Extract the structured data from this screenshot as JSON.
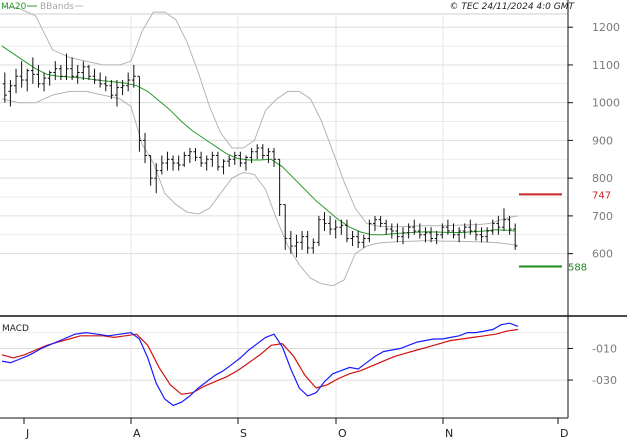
{
  "chart_data": {
    "type": "line",
    "header": {
      "ma_legend": "MA20",
      "bb_legend": "BBands",
      "copyright": "© TEC 24/11/2024 4:0 GMT",
      "macd_title": "MACD"
    },
    "x_axis_labels": [
      "J",
      "A",
      "S",
      "O",
      "N",
      "D"
    ],
    "price_axis": {
      "ticks": [
        1200,
        1100,
        1000,
        900,
        800,
        700,
        600
      ],
      "tick_labels": [
        "1200",
        "1100",
        "1000",
        "900",
        "800",
        "700",
        "600"
      ],
      "range": [
        440,
        1235
      ],
      "grid": true
    },
    "macd_axis": {
      "ticks": [
        -10,
        -30
      ],
      "tick_labels": [
        "-010",
        "-030"
      ],
      "range": [
        -54,
        8
      ]
    },
    "levels": [
      {
        "label": "747",
        "value": 757,
        "color": "#c62828"
      },
      {
        "label": "588",
        "value": 566,
        "color": "#1d8a1d"
      }
    ],
    "colors": {
      "price_bars": "#111111",
      "ma20": "#2a9a2a",
      "bbands": "#b5b5b5",
      "macd": "#1a1aff",
      "signal": "#d01010",
      "grid": "#dcdcdc"
    },
    "price_bars": [
      [
        1,
        1050,
        1080,
        1000,
        1020
      ],
      [
        3,
        1030,
        1060,
        990,
        1045
      ],
      [
        5,
        1045,
        1090,
        1025,
        1070
      ],
      [
        7,
        1070,
        1110,
        1040,
        1060
      ],
      [
        9,
        1060,
        1090,
        1030,
        1085
      ],
      [
        11,
        1085,
        1120,
        1050,
        1075
      ],
      [
        13,
        1075,
        1100,
        1040,
        1050
      ],
      [
        15,
        1050,
        1080,
        1030,
        1065
      ],
      [
        17,
        1065,
        1085,
        1045,
        1080
      ],
      [
        19,
        1080,
        1110,
        1060,
        1090
      ],
      [
        21,
        1090,
        1100,
        1060,
        1070
      ],
      [
        23,
        1070,
        1130,
        1060,
        1090
      ],
      [
        25,
        1090,
        1120,
        1060,
        1070
      ],
      [
        27,
        1070,
        1100,
        1050,
        1080
      ],
      [
        29,
        1080,
        1110,
        1060,
        1095
      ],
      [
        31,
        1095,
        1100,
        1060,
        1070
      ],
      [
        33,
        1070,
        1090,
        1050,
        1060
      ],
      [
        35,
        1060,
        1080,
        1040,
        1050
      ],
      [
        37,
        1050,
        1070,
        1030,
        1045
      ],
      [
        39,
        1045,
        1060,
        1010,
        1020
      ],
      [
        41,
        1020,
        1060,
        990,
        1040
      ],
      [
        43,
        1040,
        1060,
        1020,
        1045
      ],
      [
        45,
        1045,
        1080,
        1030,
        1060
      ],
      [
        47,
        1060,
        1100,
        1040,
        1070
      ],
      [
        49,
        1070,
        1000,
        870,
        900
      ],
      [
        51,
        900,
        920,
        840,
        860
      ],
      [
        53,
        860,
        850,
        780,
        800
      ],
      [
        55,
        800,
        840,
        760,
        820
      ],
      [
        57,
        820,
        860,
        810,
        840
      ],
      [
        59,
        840,
        870,
        820,
        850
      ],
      [
        61,
        850,
        860,
        820,
        840
      ],
      [
        63,
        840,
        860,
        820,
        835
      ],
      [
        65,
        835,
        870,
        830,
        860
      ],
      [
        67,
        860,
        880,
        840,
        870
      ],
      [
        69,
        870,
        880,
        845,
        855
      ],
      [
        71,
        855,
        870,
        830,
        840
      ],
      [
        73,
        840,
        860,
        820,
        850
      ],
      [
        75,
        850,
        870,
        830,
        860
      ],
      [
        77,
        860,
        870,
        820,
        830
      ],
      [
        79,
        830,
        850,
        810,
        845
      ],
      [
        81,
        845,
        860,
        830,
        850
      ],
      [
        83,
        850,
        870,
        835,
        860
      ],
      [
        85,
        860,
        870,
        830,
        840
      ],
      [
        87,
        840,
        860,
        820,
        855
      ],
      [
        89,
        855,
        880,
        840,
        870
      ],
      [
        91,
        870,
        890,
        850,
        880
      ],
      [
        93,
        880,
        890,
        850,
        860
      ],
      [
        95,
        860,
        880,
        840,
        870
      ],
      [
        97,
        870,
        880,
        830,
        850
      ],
      [
        99,
        850,
        820,
        700,
        730
      ],
      [
        101,
        730,
        700,
        610,
        640
      ],
      [
        103,
        640,
        660,
        600,
        620
      ],
      [
        105,
        620,
        650,
        590,
        630
      ],
      [
        107,
        630,
        660,
        610,
        645
      ],
      [
        109,
        645,
        660,
        600,
        615
      ],
      [
        111,
        615,
        640,
        600,
        630
      ],
      [
        113,
        630,
        700,
        620,
        690
      ],
      [
        115,
        690,
        710,
        660,
        680
      ],
      [
        117,
        680,
        700,
        650,
        665
      ],
      [
        119,
        665,
        690,
        640,
        670
      ],
      [
        121,
        670,
        690,
        650,
        675
      ],
      [
        123,
        675,
        690,
        630,
        640
      ],
      [
        125,
        640,
        660,
        620,
        645
      ],
      [
        127,
        645,
        660,
        615,
        630
      ],
      [
        129,
        630,
        650,
        615,
        640
      ],
      [
        131,
        640,
        690,
        630,
        680
      ],
      [
        133,
        680,
        700,
        660,
        690
      ],
      [
        135,
        690,
        700,
        670,
        680
      ],
      [
        137,
        680,
        690,
        650,
        665
      ],
      [
        139,
        665,
        680,
        640,
        660
      ],
      [
        141,
        660,
        680,
        630,
        645
      ],
      [
        143,
        645,
        670,
        625,
        655
      ],
      [
        145,
        655,
        680,
        640,
        670
      ],
      [
        147,
        670,
        690,
        650,
        660
      ],
      [
        149,
        660,
        680,
        640,
        650
      ],
      [
        151,
        650,
        670,
        630,
        655
      ],
      [
        153,
        655,
        670,
        630,
        640
      ],
      [
        155,
        640,
        660,
        625,
        650
      ],
      [
        157,
        650,
        680,
        640,
        670
      ],
      [
        159,
        670,
        690,
        650,
        660
      ],
      [
        161,
        660,
        680,
        640,
        650
      ],
      [
        163,
        650,
        670,
        630,
        660
      ],
      [
        165,
        660,
        680,
        640,
        670
      ],
      [
        167,
        670,
        690,
        650,
        660
      ],
      [
        169,
        660,
        680,
        635,
        650
      ],
      [
        171,
        650,
        670,
        630,
        645
      ],
      [
        173,
        645,
        670,
        630,
        660
      ],
      [
        175,
        660,
        690,
        650,
        680
      ],
      [
        177,
        680,
        700,
        650,
        670
      ],
      [
        179,
        670,
        720,
        660,
        690
      ],
      [
        181,
        690,
        700,
        650,
        665
      ],
      [
        183,
        665,
        680,
        610,
        620
      ]
    ],
    "ma20": [
      [
        0,
        1150
      ],
      [
        4,
        1130
      ],
      [
        8,
        1110
      ],
      [
        12,
        1090
      ],
      [
        16,
        1075
      ],
      [
        20,
        1070
      ],
      [
        24,
        1068
      ],
      [
        28,
        1066
      ],
      [
        32,
        1062
      ],
      [
        36,
        1058
      ],
      [
        40,
        1055
      ],
      [
        44,
        1052
      ],
      [
        48,
        1045
      ],
      [
        52,
        1030
      ],
      [
        56,
        1005
      ],
      [
        60,
        980
      ],
      [
        64,
        950
      ],
      [
        68,
        925
      ],
      [
        72,
        905
      ],
      [
        76,
        885
      ],
      [
        80,
        865
      ],
      [
        84,
        852
      ],
      [
        88,
        848
      ],
      [
        92,
        848
      ],
      [
        96,
        850
      ],
      [
        100,
        830
      ],
      [
        104,
        800
      ],
      [
        108,
        770
      ],
      [
        112,
        740
      ],
      [
        116,
        715
      ],
      [
        120,
        690
      ],
      [
        124,
        670
      ],
      [
        128,
        657
      ],
      [
        132,
        650
      ],
      [
        136,
        650
      ],
      [
        140,
        653
      ],
      [
        144,
        655
      ],
      [
        148,
        657
      ],
      [
        152,
        658
      ],
      [
        156,
        657
      ],
      [
        160,
        656
      ],
      [
        164,
        656
      ],
      [
        168,
        658
      ],
      [
        172,
        660
      ],
      [
        176,
        663
      ],
      [
        180,
        662
      ],
      [
        183,
        660
      ]
    ],
    "bb_upper": [
      [
        0,
        1255
      ],
      [
        6,
        1250
      ],
      [
        12,
        1230
      ],
      [
        18,
        1140
      ],
      [
        24,
        1120
      ],
      [
        30,
        1110
      ],
      [
        36,
        1100
      ],
      [
        42,
        1100
      ],
      [
        46,
        1110
      ],
      [
        50,
        1190
      ],
      [
        54,
        1240
      ],
      [
        58,
        1240
      ],
      [
        62,
        1220
      ],
      [
        66,
        1160
      ],
      [
        70,
        1080
      ],
      [
        74,
        990
      ],
      [
        78,
        920
      ],
      [
        82,
        880
      ],
      [
        86,
        880
      ],
      [
        90,
        900
      ],
      [
        94,
        980
      ],
      [
        98,
        1010
      ],
      [
        102,
        1030
      ],
      [
        106,
        1030
      ],
      [
        110,
        1010
      ],
      [
        114,
        950
      ],
      [
        118,
        870
      ],
      [
        122,
        790
      ],
      [
        126,
        720
      ],
      [
        130,
        680
      ],
      [
        134,
        673
      ],
      [
        138,
        671
      ],
      [
        142,
        671
      ],
      [
        146,
        673
      ],
      [
        150,
        674
      ],
      [
        154,
        674
      ],
      [
        158,
        674
      ],
      [
        162,
        675
      ],
      [
        166,
        676
      ],
      [
        170,
        677
      ],
      [
        174,
        680
      ],
      [
        178,
        690
      ],
      [
        182,
        697
      ],
      [
        184,
        700
      ]
    ],
    "bb_lower": [
      [
        0,
        1010
      ],
      [
        6,
        1000
      ],
      [
        12,
        1000
      ],
      [
        18,
        1020
      ],
      [
        24,
        1030
      ],
      [
        30,
        1030
      ],
      [
        36,
        1020
      ],
      [
        42,
        1010
      ],
      [
        46,
        990
      ],
      [
        50,
        890
      ],
      [
        54,
        840
      ],
      [
        58,
        760
      ],
      [
        62,
        730
      ],
      [
        66,
        710
      ],
      [
        70,
        705
      ],
      [
        74,
        720
      ],
      [
        78,
        760
      ],
      [
        82,
        800
      ],
      [
        86,
        815
      ],
      [
        90,
        810
      ],
      [
        94,
        770
      ],
      [
        98,
        690
      ],
      [
        102,
        620
      ],
      [
        106,
        570
      ],
      [
        110,
        535
      ],
      [
        114,
        520
      ],
      [
        118,
        515
      ],
      [
        122,
        530
      ],
      [
        126,
        600
      ],
      [
        130,
        620
      ],
      [
        134,
        628
      ],
      [
        138,
        630
      ],
      [
        142,
        632
      ],
      [
        146,
        633
      ],
      [
        150,
        634
      ],
      [
        154,
        634
      ],
      [
        158,
        633
      ],
      [
        162,
        633
      ],
      [
        166,
        632
      ],
      [
        170,
        631
      ],
      [
        174,
        630
      ],
      [
        178,
        628
      ],
      [
        182,
        624
      ],
      [
        184,
        622
      ]
    ],
    "macd": [
      [
        0,
        -18
      ],
      [
        3,
        -19
      ],
      [
        6,
        -17
      ],
      [
        10,
        -14
      ],
      [
        14,
        -10
      ],
      [
        18,
        -7
      ],
      [
        22,
        -4
      ],
      [
        26,
        -1
      ],
      [
        30,
        0
      ],
      [
        34,
        -1
      ],
      [
        38,
        -2
      ],
      [
        42,
        -1
      ],
      [
        46,
        0
      ],
      [
        49,
        -4
      ],
      [
        52,
        -16
      ],
      [
        55,
        -32
      ],
      [
        58,
        -42
      ],
      [
        61,
        -46
      ],
      [
        64,
        -44
      ],
      [
        67,
        -40
      ],
      [
        70,
        -35
      ],
      [
        73,
        -31
      ],
      [
        76,
        -27
      ],
      [
        79,
        -24
      ],
      [
        82,
        -20
      ],
      [
        85,
        -16
      ],
      [
        88,
        -11
      ],
      [
        91,
        -7
      ],
      [
        94,
        -3
      ],
      [
        97,
        -1
      ],
      [
        100,
        -9
      ],
      [
        103,
        -23
      ],
      [
        106,
        -35
      ],
      [
        109,
        -40
      ],
      [
        112,
        -38
      ],
      [
        115,
        -31
      ],
      [
        118,
        -26
      ],
      [
        121,
        -24
      ],
      [
        124,
        -22
      ],
      [
        127,
        -23
      ],
      [
        130,
        -19
      ],
      [
        133,
        -15
      ],
      [
        136,
        -12
      ],
      [
        139,
        -11
      ],
      [
        142,
        -10
      ],
      [
        145,
        -8
      ],
      [
        148,
        -6
      ],
      [
        151,
        -5
      ],
      [
        154,
        -4
      ],
      [
        157,
        -4
      ],
      [
        160,
        -3
      ],
      [
        163,
        -2
      ],
      [
        166,
        0
      ],
      [
        169,
        0
      ],
      [
        172,
        1
      ],
      [
        175,
        2
      ],
      [
        178,
        5
      ],
      [
        181,
        6
      ],
      [
        184,
        4
      ]
    ],
    "signal": [
      [
        0,
        -14
      ],
      [
        4,
        -16
      ],
      [
        8,
        -14
      ],
      [
        12,
        -11
      ],
      [
        16,
        -8
      ],
      [
        20,
        -6
      ],
      [
        24,
        -4
      ],
      [
        28,
        -2
      ],
      [
        32,
        -2
      ],
      [
        36,
        -2
      ],
      [
        40,
        -3
      ],
      [
        44,
        -2
      ],
      [
        48,
        -1
      ],
      [
        52,
        -8
      ],
      [
        56,
        -22
      ],
      [
        60,
        -33
      ],
      [
        64,
        -39
      ],
      [
        68,
        -38
      ],
      [
        72,
        -34
      ],
      [
        76,
        -31
      ],
      [
        80,
        -28
      ],
      [
        84,
        -24
      ],
      [
        88,
        -19
      ],
      [
        92,
        -14
      ],
      [
        96,
        -8
      ],
      [
        100,
        -7
      ],
      [
        104,
        -15
      ],
      [
        108,
        -27
      ],
      [
        112,
        -35
      ],
      [
        116,
        -33
      ],
      [
        120,
        -29
      ],
      [
        124,
        -26
      ],
      [
        128,
        -24
      ],
      [
        132,
        -21
      ],
      [
        136,
        -18
      ],
      [
        140,
        -15
      ],
      [
        144,
        -13
      ],
      [
        148,
        -11
      ],
      [
        152,
        -9
      ],
      [
        156,
        -7
      ],
      [
        160,
        -5
      ],
      [
        164,
        -4
      ],
      [
        168,
        -3
      ],
      [
        172,
        -2
      ],
      [
        176,
        -1
      ],
      [
        180,
        1
      ],
      [
        184,
        2
      ]
    ]
  }
}
